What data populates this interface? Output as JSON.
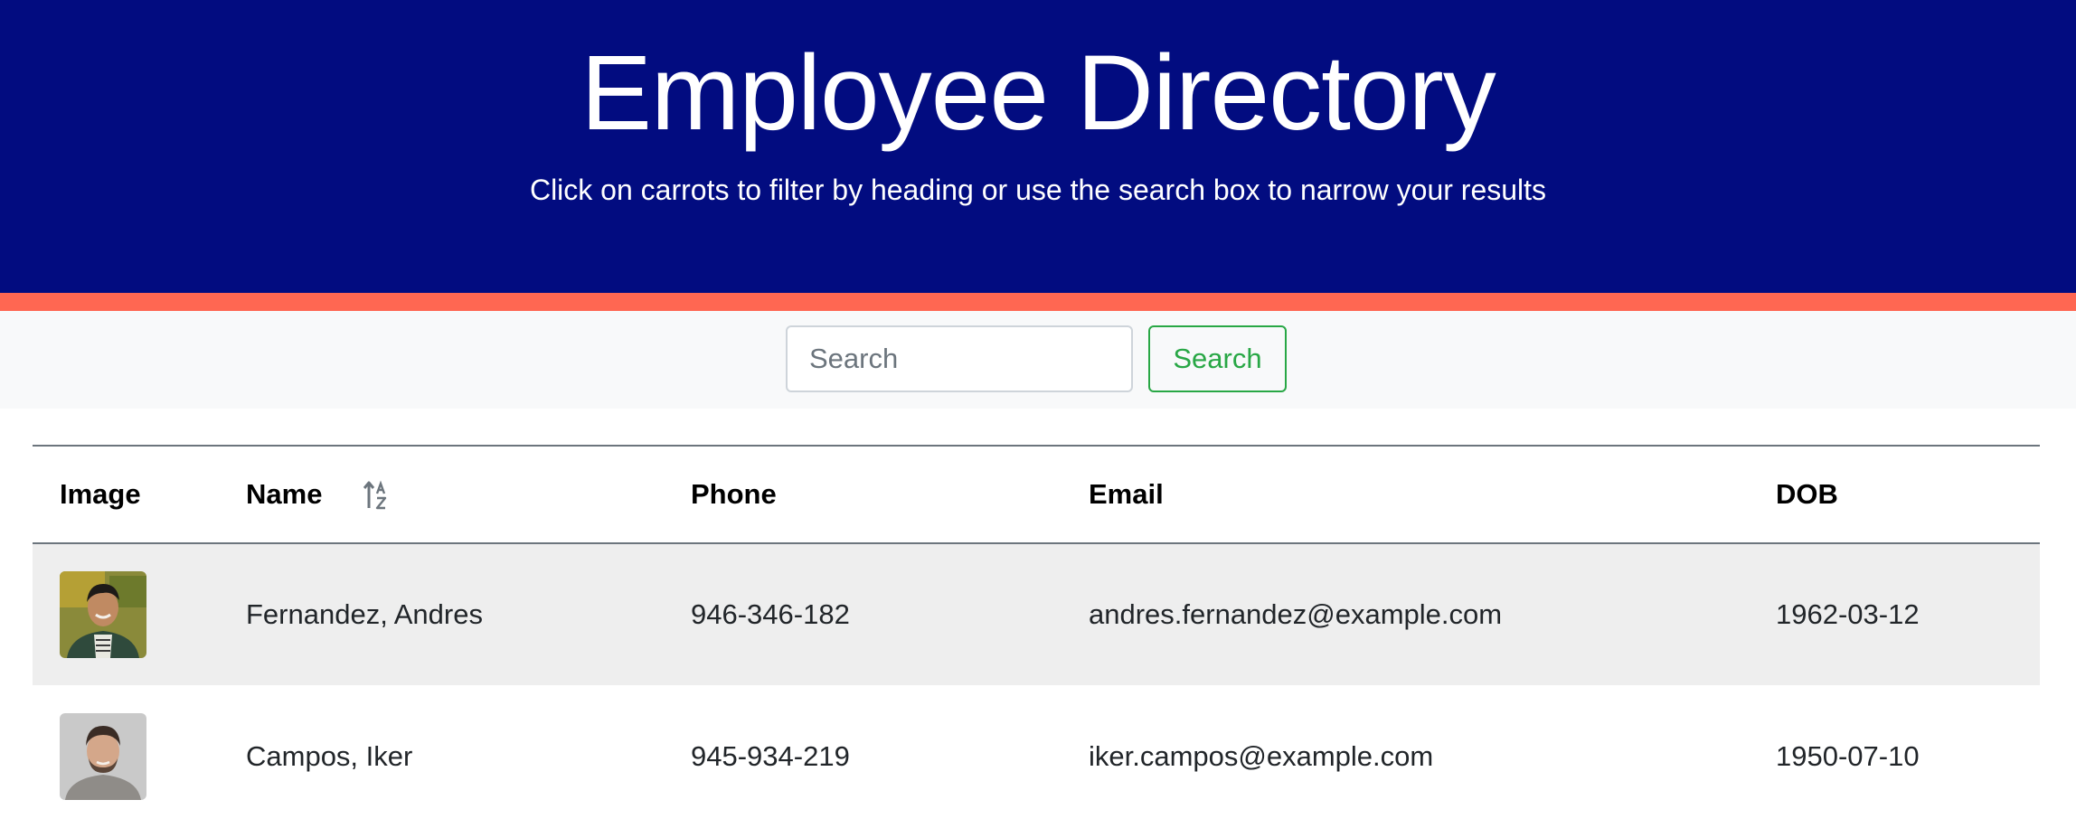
{
  "header": {
    "title": "Employee Directory",
    "subtitle": "Click on carrots to filter by heading or use the search box to narrow your results"
  },
  "search": {
    "placeholder": "Search",
    "value": "",
    "button_label": "Search"
  },
  "table": {
    "columns": [
      "Image",
      "Name",
      "Phone",
      "Email",
      "DOB"
    ],
    "sort_icon": "sort-alpha-icon",
    "rows": [
      {
        "name": "Fernandez, Andres",
        "phone": "946-346-182",
        "email": "andres.fernandez@example.com",
        "dob": "1962-03-12"
      },
      {
        "name": "Campos, Iker",
        "phone": "945-934-219",
        "email": "iker.campos@example.com",
        "dob": "1950-07-10"
      }
    ]
  },
  "colors": {
    "header_bg": "#020c80",
    "accent": "#ff6752",
    "search_button": "#28a745",
    "stripe": "#eeeeee"
  }
}
